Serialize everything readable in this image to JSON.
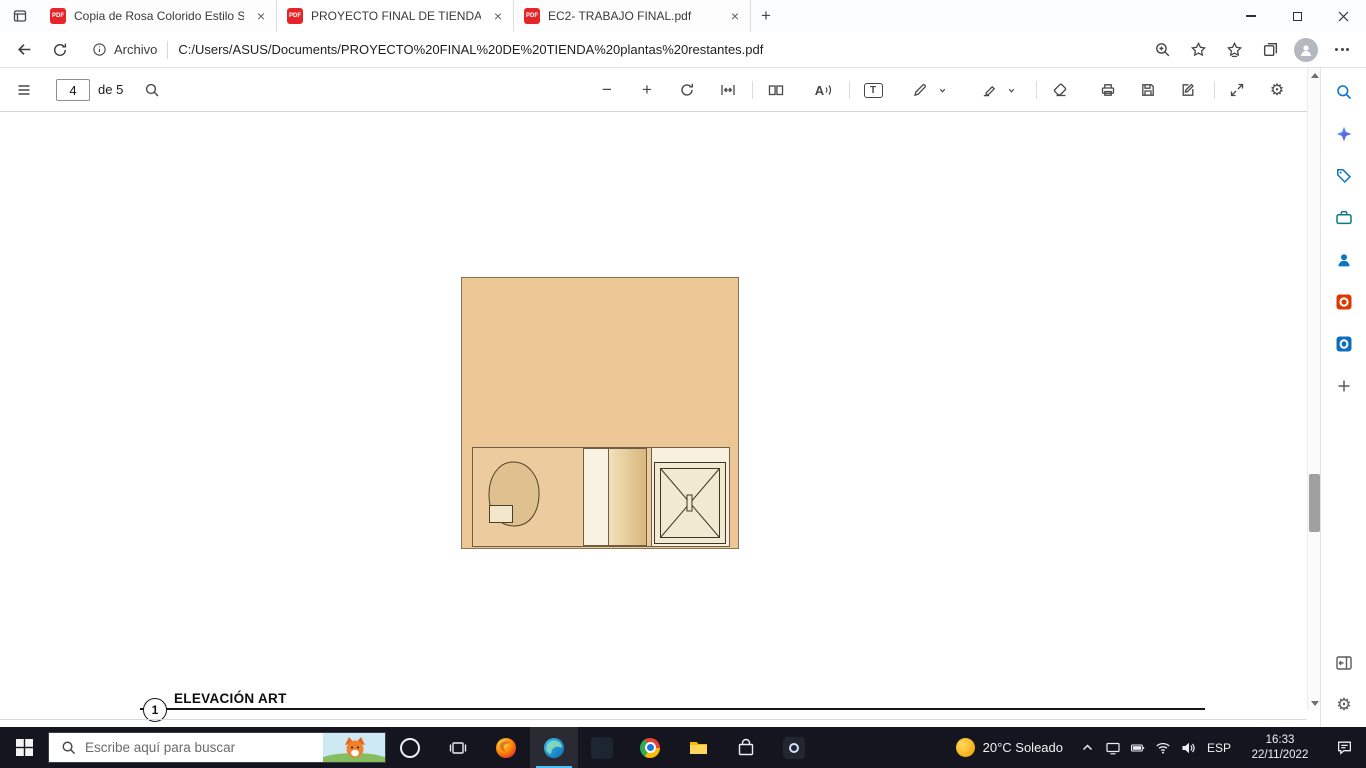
{
  "glyphs": {
    "close": "×",
    "plus": "+",
    "minus": "−",
    "pdf_badge": "PDF",
    "gear": "⚙",
    "read_aloud_letter": "A",
    "text_tool": "T"
  },
  "browser": {
    "tabs": [
      {
        "label": "Copia de Rosa Colorido Estilo Se"
      },
      {
        "label": "PROYECTO FINAL DE TIENDA pla"
      },
      {
        "label": "EC2- TRABAJO FINAL.pdf"
      }
    ],
    "address": {
      "file_chip": "Archivo",
      "url": "C:/Users/ASUS/Documents/PROYECTO%20FINAL%20DE%20TIENDA%20plantas%20restantes.pdf"
    }
  },
  "pdf_toolbar": {
    "page_input": "4",
    "page_count": "de 5"
  },
  "document": {
    "view_number": "1",
    "view_title": "ELEVACIÓN ART"
  },
  "taskbar": {
    "search_placeholder": "Escribe aquí para buscar",
    "weather": "20°C Soleado",
    "language": "ESP",
    "time": "16:33",
    "date": "22/11/2022"
  },
  "colors": {
    "facade_tan": "#ecc795",
    "taskbar_bg": "#15151f",
    "pdf_icon_red": "#e5252a",
    "edge_accent": "#4cc2ff"
  }
}
